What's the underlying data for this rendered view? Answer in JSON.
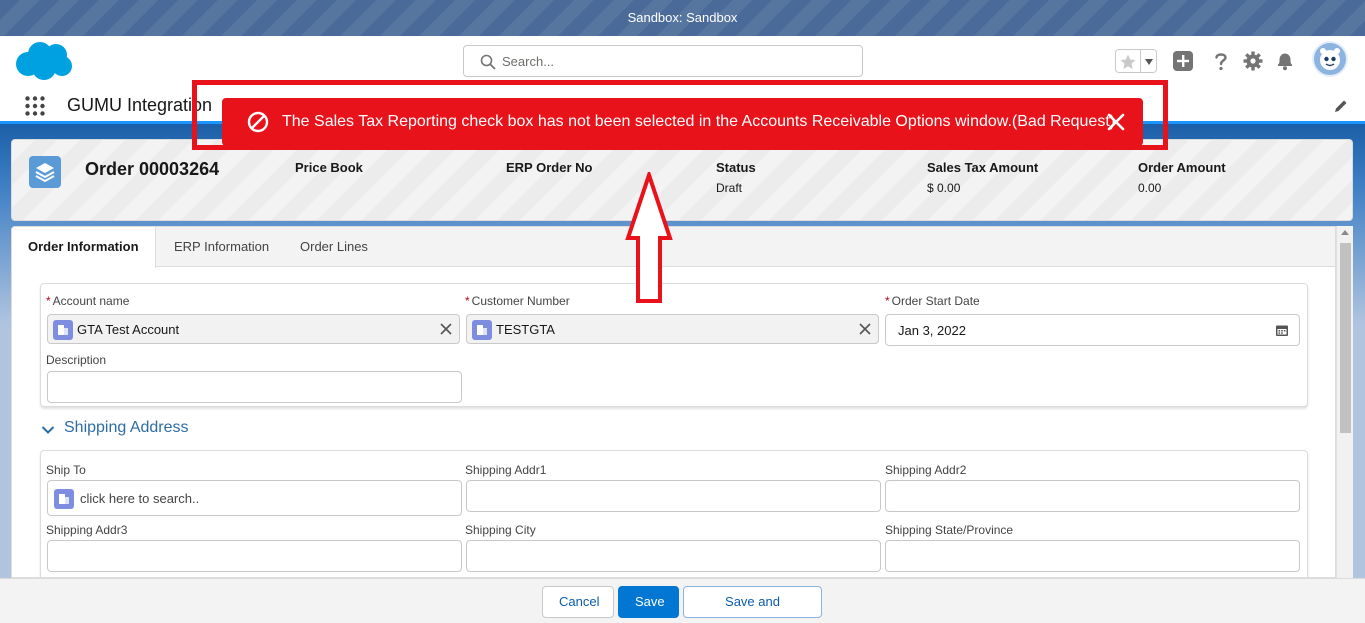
{
  "sandbox_bar": {
    "text": "Sandbox: Sandbox"
  },
  "header": {
    "search_placeholder": "Search...",
    "icons": [
      "salesforce-logo",
      "search-icon",
      "star-icon",
      "chevron-down-icon",
      "add-icon",
      "help-icon",
      "gear-icon",
      "bell-icon",
      "avatar"
    ]
  },
  "app_nav": {
    "app_name": "GUMU Integration"
  },
  "toast": {
    "message": "The Sales Tax Reporting check box has not been selected in the Accounts Receivable Options window.(Bad Request)",
    "color": "#e8121b"
  },
  "record": {
    "title": "Order 00003264",
    "highlights": [
      {
        "label": "Price Book",
        "value": ""
      },
      {
        "label": "ERP Order No",
        "value": ""
      },
      {
        "label": "Status",
        "value": "Draft"
      },
      {
        "label": "Sales Tax Amount",
        "value": "$ 0.00"
      },
      {
        "label": "Order Amount",
        "value": "0.00"
      }
    ]
  },
  "tabs": [
    {
      "label": "Order Information",
      "active": true
    },
    {
      "label": "ERP Information",
      "active": false
    },
    {
      "label": "Order Lines",
      "active": false
    }
  ],
  "order_info": {
    "account_name": {
      "label": "Account name",
      "required": true,
      "value": "GTA Test Account"
    },
    "customer_number": {
      "label": "Customer Number",
      "required": true,
      "value": "TESTGTA"
    },
    "order_start_date": {
      "label": "Order Start Date",
      "required": true,
      "value": "Jan 3, 2022"
    },
    "description": {
      "label": "Description",
      "value": ""
    }
  },
  "shipping": {
    "title": "Shipping Address",
    "ship_to": {
      "label": "Ship To",
      "placeholder": "click here to search.."
    },
    "addr1": {
      "label": "Shipping Addr1",
      "value": ""
    },
    "addr2": {
      "label": "Shipping Addr2",
      "value": ""
    },
    "addr3": {
      "label": "Shipping Addr3",
      "value": ""
    },
    "city": {
      "label": "Shipping City",
      "value": ""
    },
    "state": {
      "label": "Shipping State/Province",
      "value": ""
    }
  },
  "footer": {
    "cancel": "Cancel",
    "save": "Save",
    "save_promote": "Save and Promote"
  },
  "colors": {
    "brand": "#0176d3",
    "error": "#e8121b",
    "header_blue": "#1b5fa8"
  }
}
